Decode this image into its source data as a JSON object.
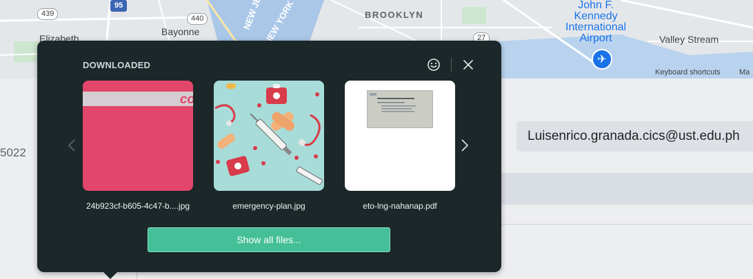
{
  "map": {
    "labels": {
      "brooklyn": "BROOKLYN",
      "bayonne": "Bayonne",
      "elizabeth": "Elizabeth",
      "valley_stream": "Valley Stream",
      "jfk_line1": "John F.",
      "jfk_line2": "Kennedy",
      "jfk_line3": "International",
      "jfk_line4": "Airport",
      "new_jersey": "NEW JERSEY",
      "new_york": "NEW YORK",
      "keyboard_shortcuts": "Keyboard shortcuts",
      "map_data_truncated": "Ma"
    },
    "route_shields": [
      "439",
      "95",
      "440",
      "27"
    ],
    "airport_icon": "airplane-icon"
  },
  "page": {
    "side_number": "5022",
    "email_value": "Luisenrico.granada.cics@ust.edu.ph"
  },
  "downloads": {
    "title": "DOWNLOADED",
    "icons": {
      "feedback": "smile-icon",
      "close": "close-icon",
      "prev": "chevron-left-icon",
      "next": "chevron-right-icon"
    },
    "files": [
      {
        "name": "24b923cf-b605-4c47-b....jpg",
        "thumb_text": "co"
      },
      {
        "name": "emergency-plan.jpg"
      },
      {
        "name": "eto-lng-nahanap.pdf"
      }
    ],
    "show_all_label": "Show all files..."
  },
  "colors": {
    "popup_bg": "#1b2729",
    "accent_button": "#45bf97",
    "card_pink": "#e2466b",
    "medical_teal": "#a8dcd8",
    "jfk_blue": "#1a73e8"
  }
}
